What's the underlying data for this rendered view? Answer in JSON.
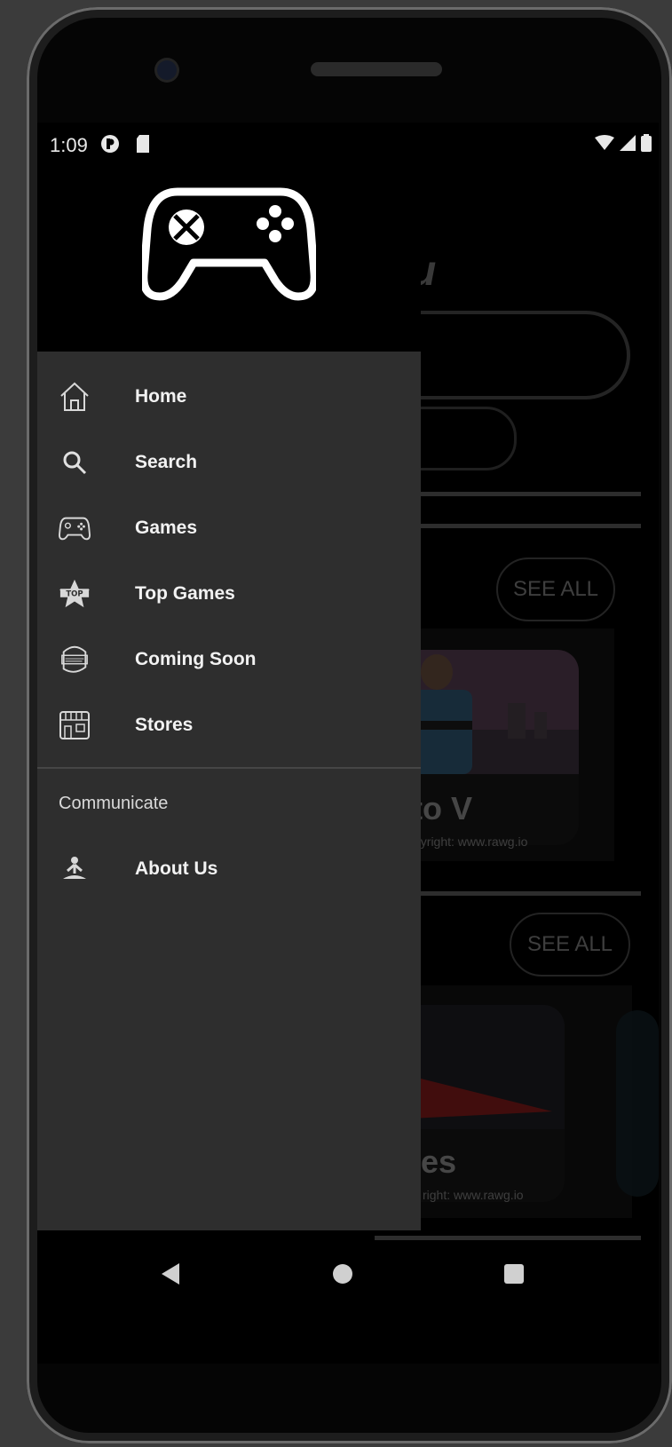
{
  "status_bar": {
    "time": "1:09"
  },
  "background": {
    "title_fragment": "u",
    "see_all_1": "SEE ALL",
    "see_all_2": "SEE ALL",
    "card1_title_fragment": "to V",
    "card1_copyright": "pyright: www.rawg.io",
    "card2_title_fragment": "es",
    "card2_copyright": "right: www.rawg.io"
  },
  "drawer": {
    "items": [
      {
        "label": "Home",
        "icon": "home-icon"
      },
      {
        "label": "Search",
        "icon": "search-icon"
      },
      {
        "label": "Games",
        "icon": "gamepad-icon"
      },
      {
        "label": "Top Games",
        "icon": "top-star-icon"
      },
      {
        "label": "Coming Soon",
        "icon": "coming-soon-icon"
      },
      {
        "label": "Stores",
        "icon": "store-icon"
      }
    ],
    "section_title": "Communicate",
    "section_items": [
      {
        "label": "About Us",
        "icon": "meditation-icon"
      }
    ]
  },
  "colors": {
    "drawer_bg": "#2e2e2e",
    "screen_bg": "#000000",
    "text": "#f2f2f2"
  }
}
